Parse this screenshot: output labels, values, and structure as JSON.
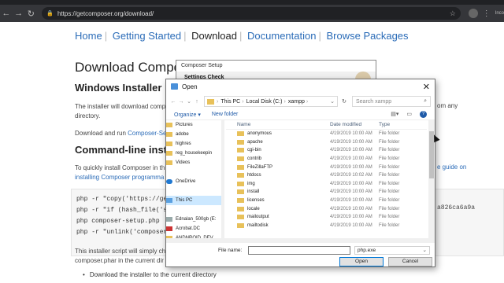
{
  "browser": {
    "url": "https://getcomposer.org/download/",
    "incognito_label": "Inco"
  },
  "site": {
    "nav": [
      "Home",
      "Getting Started",
      "Download",
      "Documentation",
      "Browse Packages"
    ],
    "heading": "Download Compos",
    "windows_heading": "Windows Installer",
    "windows_para_1": "The installer will download comp",
    "windows_para_1_right": "om any",
    "windows_para_2": "directory.",
    "download_run_prefix": "Download and run ",
    "download_run_link": "Composer-Se",
    "cli_heading": "Command-line insta",
    "cli_para_prefix": "To quickly install Composer in th",
    "cli_para_right_link": "e guide on",
    "cli_para_line2": "installing Composer programma",
    "code_lines": [
      "php -r \"copy('https://get",
      "php -r \"if (hash_file('sh",
      "php composer-setup.php",
      "php -r \"unlink('composer-"
    ],
    "code_right": "a826ca6a9a",
    "install_para_1": "This installer script will simply ch",
    "install_para_2": "composer.phar in the current dir",
    "bullet": "Download the installer to the current directory"
  },
  "setup_window": {
    "title": "Composer Setup",
    "subtitle": "Settings Check"
  },
  "dialog": {
    "title": "Open",
    "path": [
      "This PC",
      "Local Disk (C:)",
      "xampp"
    ],
    "search_placeholder": "Search xampp",
    "organize": "Organize ▾",
    "new_folder": "New folder",
    "help": "?",
    "nav_items": [
      {
        "label": "Pictures",
        "icon": "folder",
        "selected": false
      },
      {
        "label": "adobe",
        "icon": "folder",
        "selected": false
      },
      {
        "label": "highres",
        "icon": "folder",
        "selected": false
      },
      {
        "label": "reg_housekeepin",
        "icon": "folder",
        "selected": false
      },
      {
        "label": "Videos",
        "icon": "folder",
        "selected": false
      },
      {
        "label": "",
        "icon": "none",
        "selected": false
      },
      {
        "label": "OneDrive",
        "icon": "onedrive",
        "selected": false
      },
      {
        "label": "",
        "icon": "none",
        "selected": false
      },
      {
        "label": "This PC",
        "icon": "pc",
        "selected": true
      },
      {
        "label": "",
        "icon": "none",
        "selected": false
      },
      {
        "label": "Ednalan_500gb (E:",
        "icon": "drive",
        "selected": false
      },
      {
        "label": "Acrobat.DC",
        "icon": "pdf",
        "selected": false
      },
      {
        "label": "ANDNROID_DEV",
        "icon": "folder",
        "selected": false
      },
      {
        "label": "Android_apk",
        "icon": "folder",
        "selected": false
      },
      {
        "label": "ANDROID_APP",
        "icon": "folder",
        "selected": false
      }
    ],
    "columns": [
      "Name",
      "Date modified",
      "Type"
    ],
    "files": [
      {
        "name": "anonymous",
        "date": "4/19/2019 10:00 AM",
        "type": "File folder"
      },
      {
        "name": "apache",
        "date": "4/19/2019 10:00 AM",
        "type": "File folder"
      },
      {
        "name": "cgi-bin",
        "date": "4/19/2019 10:00 AM",
        "type": "File folder"
      },
      {
        "name": "contrib",
        "date": "4/19/2019 10:00 AM",
        "type": "File folder"
      },
      {
        "name": "FileZillaFTP",
        "date": "4/19/2019 10:00 AM",
        "type": "File folder"
      },
      {
        "name": "htdocs",
        "date": "4/19/2019 10:02 AM",
        "type": "File folder"
      },
      {
        "name": "img",
        "date": "4/19/2019 10:00 AM",
        "type": "File folder"
      },
      {
        "name": "install",
        "date": "4/19/2019 10:00 AM",
        "type": "File folder"
      },
      {
        "name": "licenses",
        "date": "4/19/2019 10:00 AM",
        "type": "File folder"
      },
      {
        "name": "locale",
        "date": "4/19/2019 10:00 AM",
        "type": "File folder"
      },
      {
        "name": "mailoutput",
        "date": "4/19/2019 10:00 AM",
        "type": "File folder"
      },
      {
        "name": "mailtodisk",
        "date": "4/19/2019 10:00 AM",
        "type": "File folder"
      }
    ],
    "file_name_label": "File name:",
    "file_name_value": "",
    "file_type": "php.exe",
    "open_button": "Open",
    "cancel_button": "Cancel"
  }
}
